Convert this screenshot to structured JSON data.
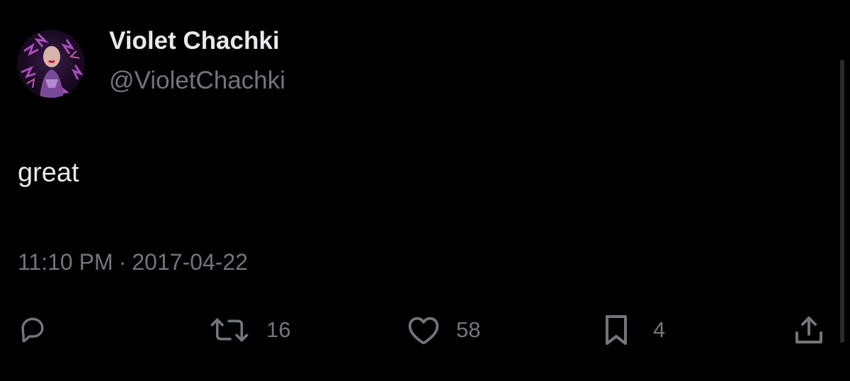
{
  "tweet": {
    "author": {
      "display_name": "Violet Chachki",
      "handle": "@VioletChachki",
      "avatar_icon": "avatar-image"
    },
    "text": "great",
    "time": "11:10 PM",
    "separator": "·",
    "date": "2017-04-22",
    "actions": {
      "reply": {
        "icon": "reply-icon",
        "count": ""
      },
      "retweet": {
        "icon": "retweet-icon",
        "count": "16"
      },
      "like": {
        "icon": "heart-icon",
        "count": "58"
      },
      "bookmark": {
        "icon": "bookmark-icon",
        "count": "4"
      },
      "share": {
        "icon": "share-icon",
        "count": ""
      }
    }
  },
  "colors": {
    "background": "#000000",
    "primary_text": "#e7e9ea",
    "secondary_text": "#71767b"
  }
}
